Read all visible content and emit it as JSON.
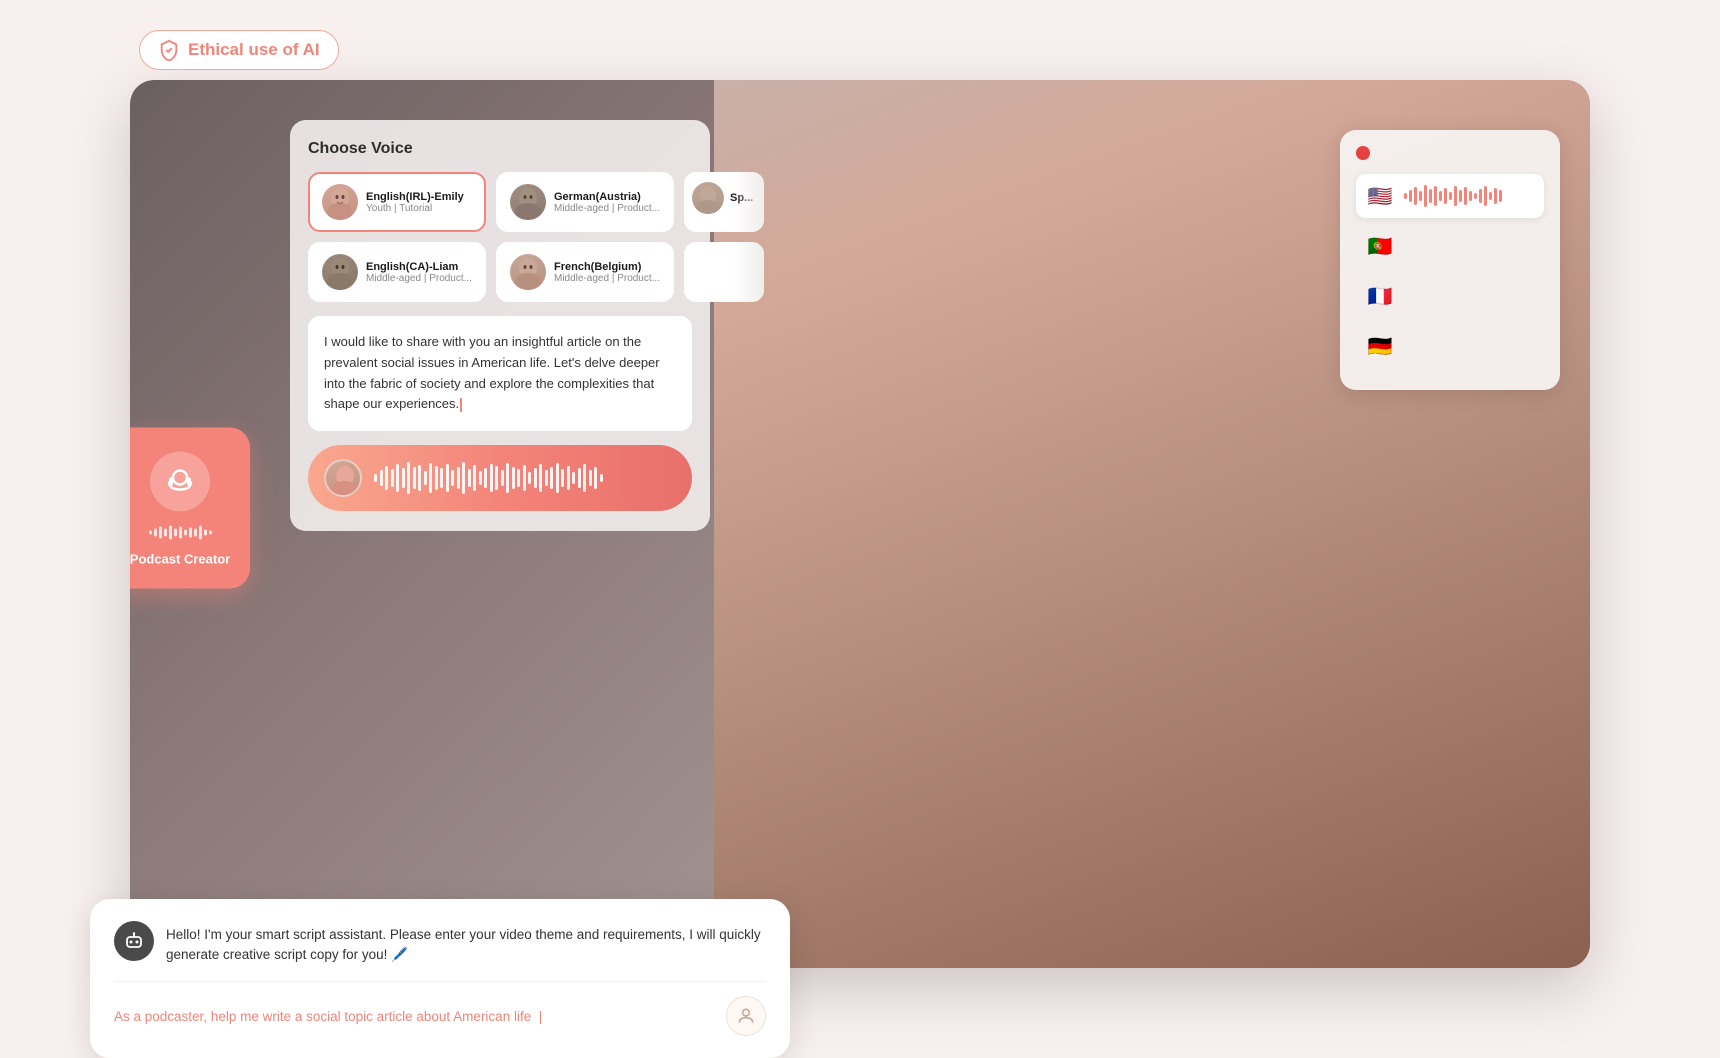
{
  "badge": {
    "icon": "✓",
    "text": "Ethical use of AI"
  },
  "podcast_creator": {
    "label": "Podcast Creator"
  },
  "voice_panel": {
    "title": "Choose Voice",
    "voices": [
      {
        "name": "English(IRL)-Emily",
        "desc": "Youth | Tutorial",
        "active": true
      },
      {
        "name": "German(Austria)",
        "desc": "Middle-aged | Product...",
        "active": false
      },
      {
        "name": "Sp...",
        "desc": "",
        "active": false
      },
      {
        "name": "English(CA)-Liam",
        "desc": "Middle-aged | Product...",
        "active": false
      },
      {
        "name": "French(Belgium)",
        "desc": "Middle-aged | Product...",
        "active": false
      }
    ]
  },
  "script": {
    "text": "I would like to share with you an insightful article on the prevalent social issues in American life. Let's delve deeper into the fabric of society and explore the complexities that shape our experiences."
  },
  "languages": [
    {
      "flag": "🇺🇸",
      "active": true
    },
    {
      "flag": "🇵🇹",
      "active": false
    },
    {
      "flag": "🇫🇷",
      "active": false
    },
    {
      "flag": "🇩🇪",
      "active": false
    }
  ],
  "chat": {
    "assistant_message": "Hello! I'm your smart script assistant. Please enter your video theme and requirements, I will quickly generate creative script copy for you! 🖊️",
    "user_input": "As a podcaster, help me write a social topic article about American life  |"
  }
}
